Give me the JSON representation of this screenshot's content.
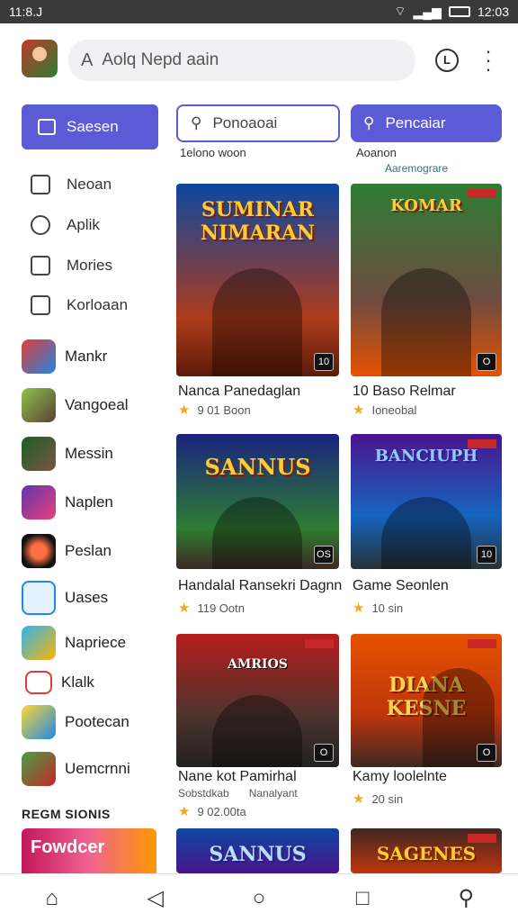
{
  "status": {
    "left_time": "11:8.J",
    "right_time": "12:03"
  },
  "header": {
    "search_placeholder": "Aolq Nepd aain",
    "clock_label": "L"
  },
  "sidebar": {
    "primary_button": "Saesen",
    "nav_items": [
      "Neoan",
      "Aplik",
      "Mories",
      "Korloaan"
    ],
    "apps": [
      {
        "label": "Mankr",
        "color": "#e53935"
      },
      {
        "label": "Vangoeal",
        "color": "#5d8f3a"
      },
      {
        "label": "Messin",
        "color": "#2e5d2e"
      },
      {
        "label": "Naplen",
        "color": "#7b3fbf"
      },
      {
        "label": "Peslan",
        "color": "#e64a19"
      },
      {
        "label": "Uases",
        "color": "#1e88e5"
      },
      {
        "label": "Napriece",
        "color": "#29a3d6"
      },
      {
        "label": "Klalk",
        "color": "#ffffff"
      },
      {
        "label": "Pootecan",
        "color": "#fbc02d"
      },
      {
        "label": "Uemcrnni",
        "color": "#2e7d32"
      }
    ],
    "section_title": "REGM SIONIS",
    "promo_text": "Fowdcer"
  },
  "main": {
    "search_left": "Ponoaoai",
    "search_right": "Pencaiar",
    "sub_left": "1elono woon",
    "sub_right": "Aoanon",
    "sub_right2": "Aaremograre",
    "cards": [
      {
        "art": "SUMINAR NIMARAN",
        "title": "Nanca Panedaglan",
        "meta": "9 01 Boon",
        "badge": "10"
      },
      {
        "art": "KOMAR",
        "title": "10 Baso Relmar",
        "meta": "Ioneobal",
        "badge": "O"
      },
      {
        "art": "SANNUS",
        "title": "Handalal Ransekri Dagnn",
        "meta": "119 Ootn",
        "badge": "OS"
      },
      {
        "art": "BANCIUPH",
        "title": "Game Seonlen",
        "meta": "10 sin",
        "badge": "10"
      },
      {
        "art": "AMRIOS",
        "title": "Nane kot Pamirhal",
        "meta": "9 02.00ta",
        "badge": "O"
      },
      {
        "art": "DIANA KESNE",
        "title": "Kamy loolelnte",
        "meta": "20 sin",
        "badge": "O"
      }
    ],
    "card5_sub1": "Sobstdkab",
    "card5_sub2": "Nanalyant",
    "bottom_art1": "SANNUS",
    "bottom_art2": "SAGENES"
  },
  "icons": {
    "home": "home-icon",
    "back": "back-icon",
    "circle": "home-circle-icon",
    "square": "recents-icon",
    "search": "search-icon"
  }
}
